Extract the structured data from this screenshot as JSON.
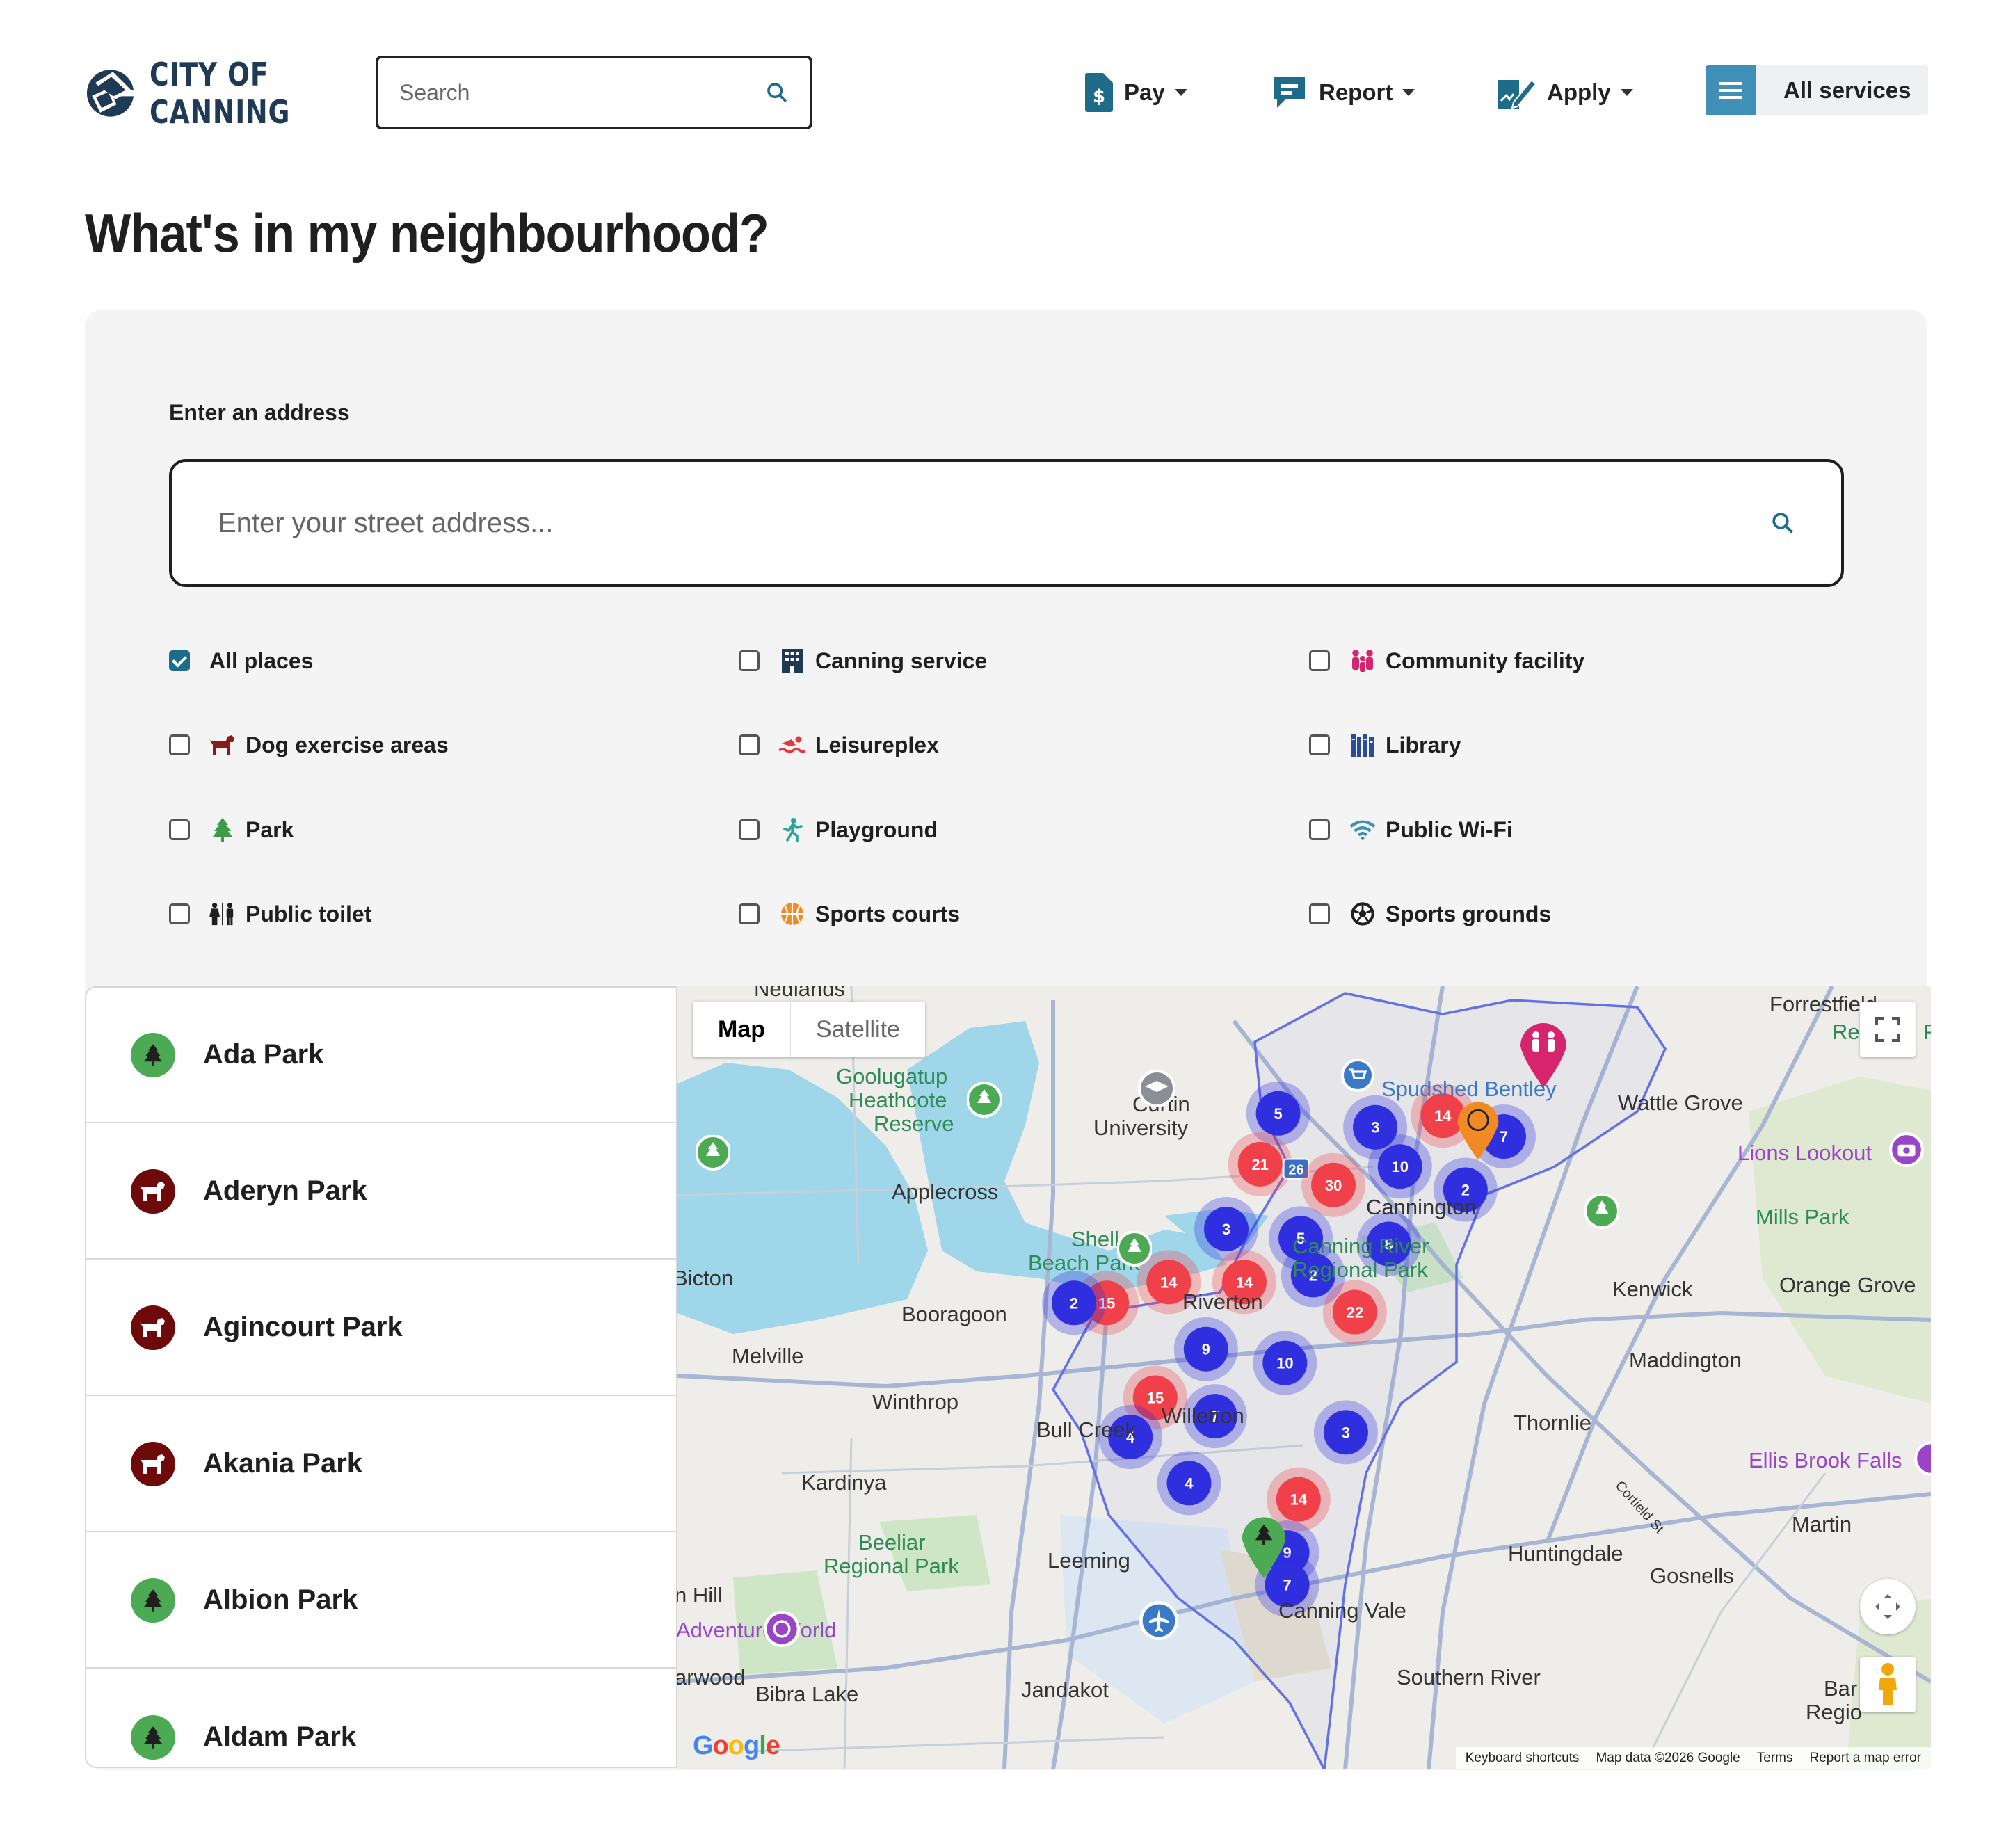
{
  "logo": {
    "line1": "CITY OF",
    "line2": "CANNING"
  },
  "search": {
    "placeholder": "Search"
  },
  "nav": [
    {
      "label": "Pay"
    },
    {
      "label": "Report"
    },
    {
      "label": "Apply"
    }
  ],
  "all_services": "All services",
  "page_title": "What's in my neighbourhood?",
  "address": {
    "label": "Enter an address",
    "placeholder": "Enter your street address..."
  },
  "filters": [
    {
      "label": "All places",
      "checked": true,
      "icon": "checkmark"
    },
    {
      "label": "Canning service",
      "checked": false,
      "icon": "building-icon",
      "color": "#1e3a55"
    },
    {
      "label": "Community facility",
      "checked": false,
      "icon": "people-icon",
      "color": "#d6246e"
    },
    {
      "label": "Dog exercise areas",
      "checked": false,
      "icon": "dog-icon",
      "color": "#8b1a1a"
    },
    {
      "label": "Leisureplex",
      "checked": false,
      "icon": "swimmer-icon",
      "color": "#e23a3a"
    },
    {
      "label": "Library",
      "checked": false,
      "icon": "books-icon",
      "color": "#2a4a9a"
    },
    {
      "label": "Park",
      "checked": false,
      "icon": "tree-icon",
      "color": "#3e9a48"
    },
    {
      "label": "Playground",
      "checked": false,
      "icon": "child-icon",
      "color": "#2aa39a"
    },
    {
      "label": "Public Wi-Fi",
      "checked": false,
      "icon": "wifi-icon",
      "color": "#3f8fb6"
    },
    {
      "label": "Public toilet",
      "checked": false,
      "icon": "toilet-icon",
      "color": "#1f1f1f"
    },
    {
      "label": "Sports courts",
      "checked": false,
      "icon": "basketball-icon",
      "color": "#f08a24"
    },
    {
      "label": "Sports grounds",
      "checked": false,
      "icon": "soccer-ball-icon",
      "color": "#1f1f1f"
    }
  ],
  "places": [
    {
      "name": "Ada Park",
      "type": "park"
    },
    {
      "name": "Aderyn Park",
      "type": "dog"
    },
    {
      "name": "Agincourt Park",
      "type": "dog"
    },
    {
      "name": "Akania Park",
      "type": "dog"
    },
    {
      "name": "Albion Park",
      "type": "park"
    },
    {
      "name": "Aldam Park",
      "type": "park"
    }
  ],
  "map": {
    "type_buttons": [
      "Map",
      "Satellite"
    ],
    "labels": [
      "Nedlands",
      "Forrestfield",
      "Regional P",
      "Goolugatup",
      "Heathcote",
      "Reserve",
      "Curtin",
      "University",
      "Spudshed Bentley",
      "Wattle Grove",
      "Lions Lookout",
      "Applecross",
      "Cannington",
      "Mills Park",
      "Shelley",
      "Beach Park",
      "Canning River",
      "Regional Park",
      "Bicton",
      "Booragoon",
      "Riverton",
      "Kenwick",
      "Orange Grove",
      "Melville",
      "Maddington",
      "Winthrop",
      "Bull Creek",
      "Willetton",
      "Thornlie",
      "Ellis Brook Falls",
      "Kardinya",
      "Cortield St",
      "Martin",
      "Beeliar",
      "Regional Park",
      "Leeming",
      "Huntingdale",
      "Gosnells",
      "n Hill",
      "Canning Vale",
      "Adventure World",
      "arwood",
      "Bibra Lake",
      "Jandakot",
      "Southern River",
      "Bar",
      "Regio"
    ],
    "clusters": [
      5,
      3,
      14,
      7,
      21,
      26,
      10,
      30,
      2,
      3,
      5,
      8,
      2,
      14,
      14,
      15,
      2,
      22,
      9,
      10,
      15,
      7,
      4,
      3,
      4,
      14,
      9,
      7
    ],
    "attribution": [
      "Keyboard shortcuts",
      "Map data ©2026 Google",
      "Terms",
      "Report a map error"
    ],
    "google": "Google"
  }
}
